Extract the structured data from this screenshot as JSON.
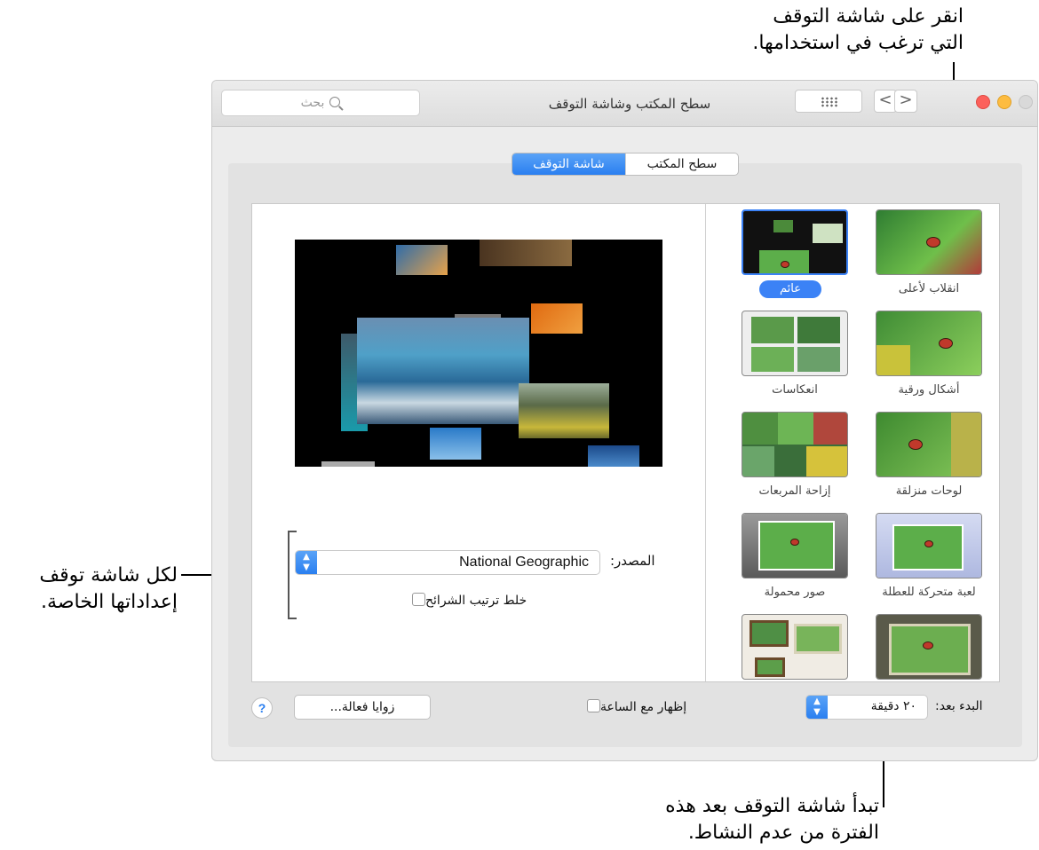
{
  "callouts": {
    "top_line1": "انقر على شاشة التوقف",
    "top_line2": "التي ترغب في استخدامها.",
    "left_line1": "لكل شاشة توقف",
    "left_line2": "إعداداتها الخاصة.",
    "bottom_line1": "تبدأ شاشة التوقف بعد هذه",
    "bottom_line2": "الفترة من عدم النشاط."
  },
  "window": {
    "title": "سطح المكتب وشاشة التوقف",
    "search_placeholder": "بحث",
    "nav_back": "<",
    "nav_forward": ">"
  },
  "tabs": [
    {
      "label": "سطح المكتب",
      "active": false
    },
    {
      "label": "شاشة التوقف",
      "active": true
    }
  ],
  "screensavers": [
    {
      "label": "انقلاب لأعلى",
      "selected": false
    },
    {
      "label": "عائم",
      "selected": true
    },
    {
      "label": "أشكال ورقية",
      "selected": false
    },
    {
      "label": "انعكاسات",
      "selected": false
    },
    {
      "label": "لوحات منزلقة",
      "selected": false
    },
    {
      "label": "إزاحة المربعات",
      "selected": false
    },
    {
      "label": "لعبة متحركة للعطلة",
      "selected": false
    },
    {
      "label": "صور محمولة",
      "selected": false
    },
    {
      "label": "",
      "selected": false
    },
    {
      "label": "",
      "selected": false
    }
  ],
  "settings": {
    "source_label": "المصدر:",
    "source_value": "National Geographic",
    "shuffle_label": "خلط ترتيب الشرائح",
    "shuffle_checked": false
  },
  "bottom": {
    "start_after_label": "البدء بعد:",
    "start_after_value": "٢٠ دقيقة",
    "show_clock_label": "إظهار مع الساعة",
    "show_clock_checked": false,
    "hot_corners_label": "زوايا فعالة...",
    "help_label": "?"
  },
  "colors": {
    "accent": "#2a7ff0",
    "close": "#d9d9d9",
    "minimize": "#fdbc40",
    "zoom": "#fc605b"
  }
}
